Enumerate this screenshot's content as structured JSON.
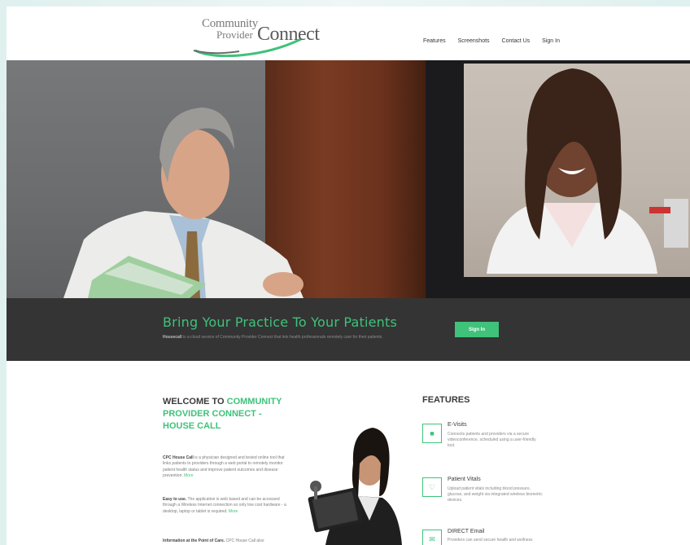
{
  "header": {
    "logo_line1": "Community",
    "logo_line2": "Provider",
    "logo_line3": "Connect",
    "nav": [
      "Features",
      "Screenshots",
      "Contact Us",
      "Sign In"
    ]
  },
  "band": {
    "title": "Bring Your Practice To Your Patients",
    "subtitle_bold": "Housecall",
    "subtitle_rest": " is a cloud service of Community Provider Connect that lets health professionals remotely care for their patients.",
    "sign_in_button": "Sign In"
  },
  "welcome": {
    "title_prefix": "WELCOME TO ",
    "title_highlight": "COMMUNITY PROVIDER CONNECT - HOUSE CALL",
    "p1_bold": "CPC House Call",
    "p1_text": " is a physician designed and tested online tool that links patients to providers through a web portal to remotely monitor patient health status and improve patient outcomes and disease prevention.",
    "p1_more": "More",
    "p2_bold": "Easy to use.",
    "p2_text": " The application is web based and can be accessed through a Wireless Internet connection so only low cost hardware - a desktop, laptop or tablet is required.",
    "p2_more": "More",
    "p3_bold": "Information at the Point of Care.",
    "p3_text": " CPC House Call also"
  },
  "features": {
    "title": "FEATURES",
    "items": [
      {
        "name": "E-Visits",
        "desc": "Connects patients and providers via a secure videoconference, scheduled using a user-friendly tool.",
        "icon": "video-camera-icon",
        "glyph": "■"
      },
      {
        "name": "Patient Vitals",
        "desc": "Upload patient vitals including blood pressure, glucose, and weight via integrated wireless biometric devices.",
        "icon": "stethoscope-icon",
        "glyph": "♡"
      },
      {
        "name": "DIRECT Email",
        "desc": "Providers can send secure health and wellness",
        "icon": "envelope-icon",
        "glyph": "✉"
      }
    ]
  },
  "colors": {
    "accent": "#3fc27a",
    "band": "#343434",
    "page_bg": "#dff0ef"
  }
}
